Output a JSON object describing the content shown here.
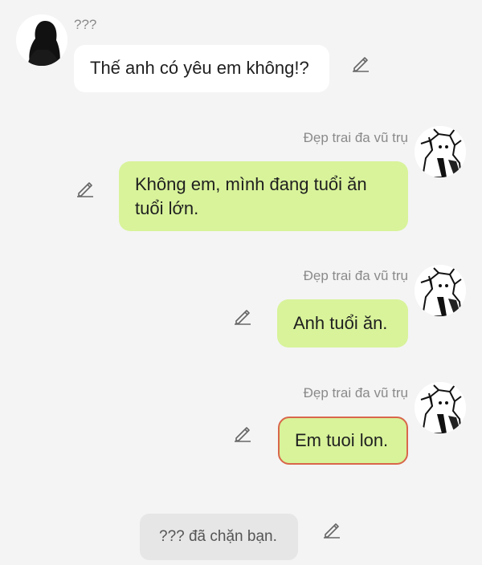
{
  "contact": {
    "name": "???",
    "avatar_icon": "silhouette-avatar-icon"
  },
  "me": {
    "name": "Đẹp trai đa vũ trụ",
    "avatar_icon": "manga-character-avatar-icon"
  },
  "messages": [
    {
      "sender": "contact",
      "text": "Thế anh có yêu em không!?"
    },
    {
      "sender": "me",
      "text": "Không em, mình đang tuổi ăn tuổi lớn."
    },
    {
      "sender": "me",
      "text": "Anh tuổi ăn."
    },
    {
      "sender": "me",
      "text": "Em tuoi lon.",
      "highlighted": true
    }
  ],
  "system_notice": "??? đã chặn bạn.",
  "icons": {
    "edit": "pencil-icon"
  },
  "colors": {
    "background": "#f4f4f4",
    "incoming_bubble": "#ffffff",
    "outgoing_bubble": "#d8f39a",
    "highlight_border": "#d9664a",
    "system_bubble": "#e6e6e6"
  }
}
